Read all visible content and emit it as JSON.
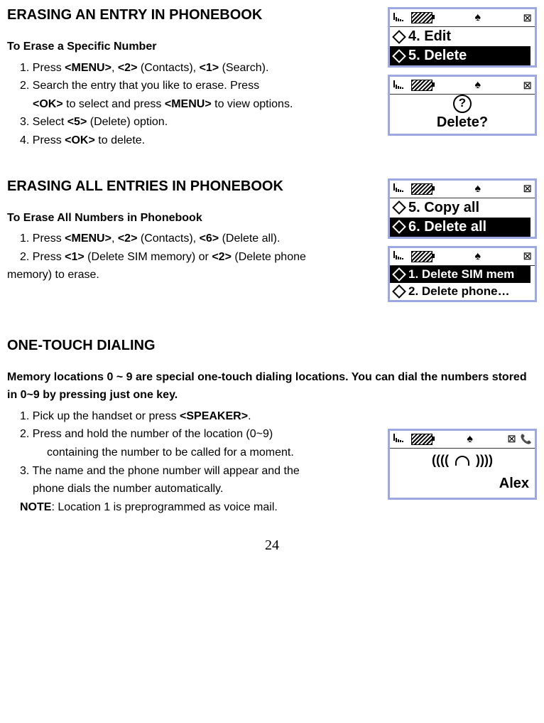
{
  "section1": {
    "title": "ERASING AN ENTRY IN PHONEBOOK",
    "subtitle": "To Erase a Specific Number",
    "step1_pre": "1. Press ",
    "menu": "<MENU>",
    "step1_mid1": ", ",
    "two": "<2>",
    "step1_contacts": " (Contacts), ",
    "one": "<1>",
    "step1_search": " (Search).",
    "step2": "2. Search the entry that you like to erase. Press",
    "step2b_ok": "<OK>",
    "step2b_mid": " to select and press ",
    "step2b_menu": "<MENU>",
    "step2b_end": " to view options.",
    "step3_pre": "3. Select ",
    "five": "<5>",
    "step3_end": " (Delete) option.",
    "step4_pre": "4. Press ",
    "step4_ok": "<OK>",
    "step4_end": " to delete."
  },
  "section2": {
    "title": "ERASING ALL ENTRIES IN PHONEBOOK",
    "subtitle": "To Erase All Numbers in Phonebook",
    "step1_pre": "1. Press ",
    "menu": "<MENU>",
    "step1_mid1": ", ",
    "two": "<2>",
    "step1_contacts": " (Contacts), ",
    "six": "<6>",
    "step1_end": " (Delete all).",
    "step2_pre": "2. Press ",
    "one": "<1>",
    "step2_mid": " (Delete SIM memory) or ",
    "two2": "<2>",
    "step2_end": " (Delete phone",
    "step2_cont": "memory) to erase."
  },
  "section3": {
    "title": "ONE-TOUCH DIALING",
    "intro": "Memory locations 0 ~ 9 are special one-touch dialing locations. You can dial the numbers stored in 0~9 by pressing just one key.",
    "step1_pre": "1. Pick up the handset or press ",
    "speaker": "<SPEAKER>",
    "step1_end": ".",
    "step2": "2. Press and hold the number of the location (0~9)",
    "step2b": "containing the number to be called for   a moment.",
    "step3": "3. The name and the phone number will appear and the",
    "step3b": "phone dials the number automatically.",
    "note_label": "NOTE",
    "note_text": ": Location 1 is preprogrammed as voice mail."
  },
  "screens": {
    "s1_row1": "4. Edit",
    "s1_row2": "5. Delete",
    "s2_text": "Delete?",
    "s3_row1": "5. Copy all",
    "s3_row2": "6. Delete all",
    "s4_row1": "1. Delete SIM mem",
    "s4_row2": "2. Delete phone…",
    "s5_anim": "((((   ☏   ))))",
    "s5_name": "Alex"
  },
  "page": "24"
}
